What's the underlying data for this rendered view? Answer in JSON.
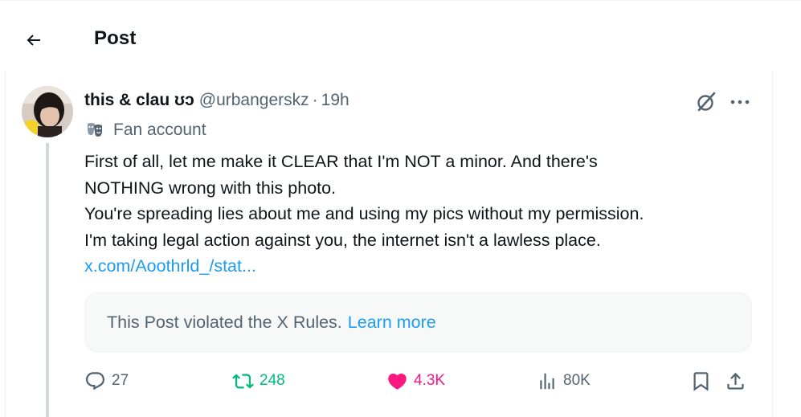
{
  "header": {
    "title": "Post"
  },
  "post": {
    "author": {
      "name": "this & clau ʊɔ",
      "handle": "@urbangerskz",
      "time": "19h"
    },
    "label": "Fan account",
    "text_lines": [
      "First of all, let me make it CLEAR that I'm NOT a minor. And there's",
      "NOTHING wrong with this photo.",
      "You're spreading lies about me and using my pics without my permission.",
      "I'm taking legal action against you, the internet isn't a lawless place."
    ],
    "link": "x.com/Aoothrld_/stat...",
    "notice": {
      "text": "This Post violated the X Rules.",
      "link": "Learn more"
    },
    "stats": {
      "replies": "27",
      "reposts": "248",
      "likes": "4.3K",
      "views": "80K"
    }
  },
  "colors": {
    "accent": "#1d9bf0",
    "repost": "#00ba7c",
    "like": "#f91880",
    "muted": "#536471",
    "text": "#0f1419"
  },
  "icons": [
    "back-arrow-icon",
    "grok-icon",
    "more-icon",
    "theater-mask-icon",
    "reply-icon",
    "repost-icon",
    "like-heart-icon",
    "views-icon",
    "bookmark-icon",
    "share-icon"
  ]
}
